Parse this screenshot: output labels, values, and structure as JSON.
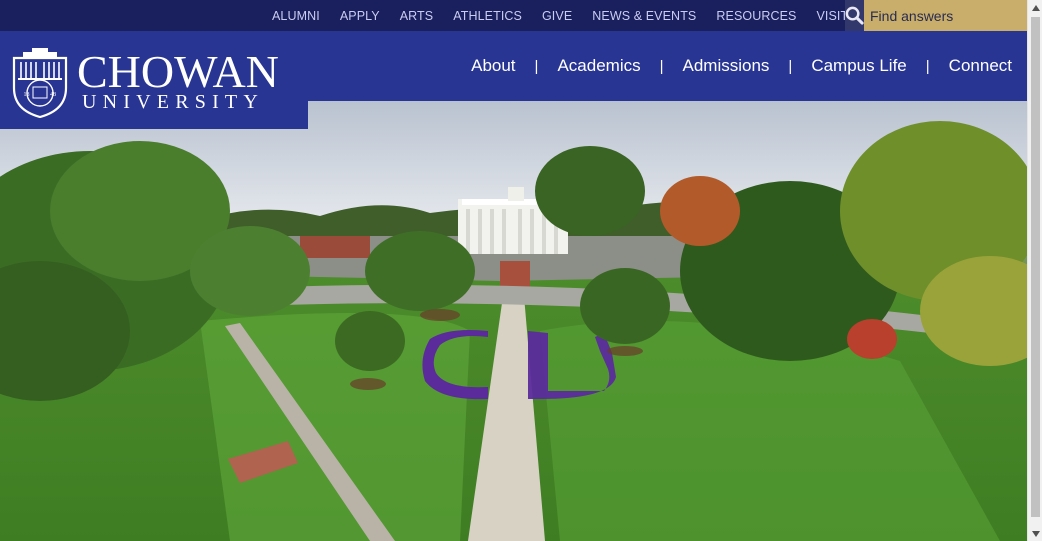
{
  "utility_nav": {
    "links": [
      "ALUMNI",
      "APPLY",
      "ARTS",
      "ATHLETICS",
      "GIVE",
      "NEWS & EVENTS",
      "RESOURCES",
      "VISIT"
    ],
    "search_placeholder": "Find answers",
    "search_icon": "search-icon"
  },
  "logo": {
    "wordmark": "CHOWAN",
    "subtitle": "UNIVERSITY",
    "seal_year_left": "18",
    "seal_year_right": "48"
  },
  "main_nav": {
    "items": [
      "About",
      "Academics",
      "Admissions",
      "Campus Life",
      "Connect"
    ],
    "separator": "|"
  },
  "colors": {
    "utility_bar": "#1a1f5e",
    "header": "#283593",
    "search_field": "#c8ae6a",
    "search_button": "#33386c"
  },
  "hero": {
    "image": "aerial-campus-photo"
  }
}
